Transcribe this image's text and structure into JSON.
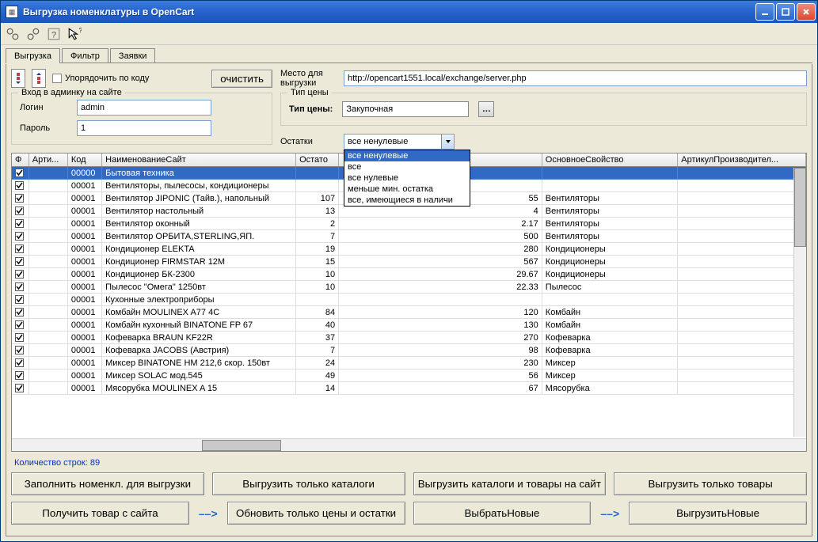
{
  "window": {
    "title": "Выгрузка номенклатуры в OpenCart"
  },
  "tabs": {
    "t0": "Выгрузка",
    "t1": "Фильтр",
    "t2": "Заявки"
  },
  "controls": {
    "sort_by_code": "Упорядочить по коду",
    "clear": "очистить",
    "upload_place_label": "Место для выгрузки",
    "upload_url": "http://opencart1551.local/exchange/server.php",
    "admin_group": "Вход в админку на сайте",
    "login_label": "Логин",
    "login_value": "admin",
    "pass_label": "Пароль",
    "pass_value": "1",
    "price_group": "Тип цены",
    "price_label": "Тип цены:",
    "price_value": "Закупочная",
    "stock_label": "Остатки",
    "stock_value": "все ненулевые",
    "stock_options": {
      "o0": "все ненулевые",
      "o1": "все",
      "o2": "все нулевые",
      "o3": "меньше мин. остатка",
      "o4": "все, имеющиеся в наличи"
    }
  },
  "grid": {
    "headers": {
      "h0": "Ф",
      "h1": "Арти...",
      "h2": "Код",
      "h3": "НаименованиеСайт",
      "h4": "Остато",
      "h5": "",
      "h6": "ОсновноеСвойство",
      "h7": "АртикулПроизводител..."
    },
    "rows": [
      {
        "chk": true,
        "code": "00000",
        "name": "Бытовая техника",
        "stock": "",
        "qty": "",
        "prop": "",
        "selected": true
      },
      {
        "chk": true,
        "code": "00001",
        "name": "Вентиляторы, пылесосы, кондиционеры",
        "stock": "",
        "qty": "",
        "prop": ""
      },
      {
        "chk": true,
        "code": "00001",
        "name": "Вентилятор JIPONIC (Тайв.), напольный",
        "stock": "107",
        "qty": "55",
        "prop": "Вентиляторы"
      },
      {
        "chk": true,
        "code": "00001",
        "name": "Вентилятор настольный",
        "stock": "13",
        "qty": "4",
        "prop": "Вентиляторы"
      },
      {
        "chk": true,
        "code": "00001",
        "name": "Вентилятор оконный",
        "stock": "2",
        "qty": "2.17",
        "prop": "Вентиляторы"
      },
      {
        "chk": true,
        "code": "00001",
        "name": "Вентилятор ОРБИТА,STERLING,ЯП.",
        "stock": "7",
        "qty": "500",
        "prop": "Вентиляторы"
      },
      {
        "chk": true,
        "code": "00001",
        "name": "Кондиционер ELEKTA",
        "stock": "19",
        "qty": "280",
        "prop": "Кондиционеры"
      },
      {
        "chk": true,
        "code": "00001",
        "name": "Кондиционер FIRMSTAR 12M",
        "stock": "15",
        "qty": "567",
        "prop": "Кондиционеры"
      },
      {
        "chk": true,
        "code": "00001",
        "name": "Кондиционер БК-2300",
        "stock": "10",
        "qty": "29.67",
        "prop": "Кондиционеры"
      },
      {
        "chk": true,
        "code": "00001",
        "name": "Пылесос \"Омега\" 1250вт",
        "stock": "10",
        "qty": "22.33",
        "prop": "Пылесос"
      },
      {
        "chk": true,
        "code": "00001",
        "name": "Кухонные электроприборы",
        "stock": "",
        "qty": "",
        "prop": ""
      },
      {
        "chk": true,
        "code": "00001",
        "name": "Комбайн MOULINEX  A77 4C",
        "stock": "84",
        "qty": "120",
        "prop": "Комбайн"
      },
      {
        "chk": true,
        "code": "00001",
        "name": "Комбайн кухонный BINATONE FP 67",
        "stock": "40",
        "qty": "130",
        "prop": "Комбайн"
      },
      {
        "chk": true,
        "code": "00001",
        "name": "Кофеварка BRAUN KF22R",
        "stock": "37",
        "qty": "270",
        "prop": "Кофеварка"
      },
      {
        "chk": true,
        "code": "00001",
        "name": "Кофеварка JACOBS (Австрия)",
        "stock": "7",
        "qty": "98",
        "prop": "Кофеварка"
      },
      {
        "chk": true,
        "code": "00001",
        "name": "Миксер BINATONE HM 212,6 скор. 150вт",
        "stock": "24",
        "qty": "230",
        "prop": "Миксер"
      },
      {
        "chk": true,
        "code": "00001",
        "name": "Миксер SOLAC мод.545",
        "stock": "49",
        "qty": "56",
        "prop": "Миксер"
      },
      {
        "chk": true,
        "code": "00001",
        "name": "Мясорубка MOULINEX  A 15",
        "stock": "14",
        "qty": "67",
        "prop": "Мясорубка"
      }
    ]
  },
  "footer": {
    "count": "Количество строк: 89",
    "b0": "Заполнить номенкл. для выгрузки",
    "b1": "Выгрузить только каталоги",
    "b2": "Выгрузить каталоги и товары на сайт",
    "b3": "Выгрузить только товары",
    "b4": "Получить товар с сайта",
    "b5": "Обновить только цены и остатки",
    "b6": "ВыбратьНовые",
    "b7": "ВыгрузитьНовые",
    "arrow": "––>"
  }
}
